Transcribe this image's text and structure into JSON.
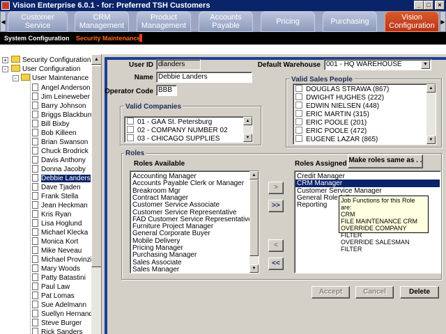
{
  "window": {
    "title": "Vision Enterprise 6.0.1 - for: Preferred TSH Customers",
    "minimize": "_",
    "maximize": "□",
    "close": "×"
  },
  "tabs": [
    {
      "label": "Customer Service"
    },
    {
      "label": "CRM Management"
    },
    {
      "label": "Product Management"
    },
    {
      "label": "Accounts Payable"
    },
    {
      "label": "Pricing"
    },
    {
      "label": "Purchasing"
    },
    {
      "label": "Vision Configuration"
    }
  ],
  "tab_scroll": {
    "left": "◀",
    "right": "▶"
  },
  "subnav": {
    "system_config": "System Configuration",
    "security_maint": "Security Maintenance"
  },
  "colors": {
    "subnav_white": "#ffffff",
    "subnav_orange": "#ff6a1a",
    "active_tab": "#c0441f"
  },
  "tree": {
    "nodes": [
      {
        "label": "Security Configuration",
        "type": "folder",
        "expander": "+"
      },
      {
        "label": "User Configuration",
        "type": "folder",
        "expander": "-"
      },
      {
        "label": "User Maintenance",
        "type": "folder",
        "expander": "-"
      }
    ],
    "users": [
      "Angel Anderson",
      "Jim Leineweber",
      "Barry Johnson",
      "Briggs Blackburn",
      "Bill Bixby",
      "Bob Killeen",
      "Brian Swanson",
      "Chuck Brodrick",
      "Davis Anthony",
      "Donna Jacoby",
      "Debbie Landers",
      "Dave Tjaden",
      "Frank Stella",
      "Jean Heckman",
      "Kris Ryan",
      "Lisa Hoglund",
      "Michael Klecka",
      "Monica Kort",
      "Mike Neveau",
      "Michael Provinzino",
      "Mary Woods",
      "Patty Batastini",
      "Paul Law",
      "Pat Lomas",
      "Sue Adelmann",
      "Suellyn Hernandez",
      "Steve Burger",
      "Rick Sanders"
    ],
    "selected_user": "Debbie Landers"
  },
  "form": {
    "user_id_label": "User ID",
    "user_id": "dlanders",
    "name_label": "Name",
    "name": "Debbie Landers",
    "operator_code_label": "Operator Code",
    "operator_code": "BBB",
    "default_warehouse_label": "Default Warehouse",
    "default_warehouse": "001 - HQ WAREHOUSE"
  },
  "valid_companies": {
    "caption": "Valid Companies",
    "items": [
      "01 - GAA St. Petersburg",
      "02 - COMPANY NUMBER 02",
      "03 - CHICAGO SUPPLIES"
    ]
  },
  "valid_sales_people": {
    "caption": "Valid Sales People",
    "items": [
      "DOUGLAS STRAWA (867)",
      "DWIGHT HUGHES (222)",
      "EDWIN NIELSEN (448)",
      "ERIC MARTIN (315)",
      "ERIC POOLE (201)",
      "ERIC POOLE (472)",
      "EUGENE LAZAR (865)"
    ]
  },
  "roles": {
    "caption": "Roles",
    "available_label": "Roles Available",
    "assigned_label": "Roles Assigned",
    "make_same_label": "Make roles same as . . .",
    "available": [
      "Accounting Manager",
      "Accounts Payable Clerk or Manager",
      "Breakroom Mgr",
      "Contract Manager",
      "Customer Service Associate",
      "Customer Service Representative",
      "FAD Customer Service Representative",
      "Furniture Project Manager",
      "General Corporate Buyer",
      "Mobile Delivery",
      "Pricing Manager",
      "Purchasing Manager",
      "Sales Associate",
      "Sales Manager"
    ],
    "assigned": [
      "Credit Manager",
      "CRM Manager",
      "Customer Service Manager",
      "General Role (all",
      "Reporting"
    ],
    "selected_assigned": "CRM Manager",
    "move_right": ">",
    "move_all_right": ">>",
    "move_left": "<",
    "move_all_left": "<<"
  },
  "tooltip": {
    "heading": "Job Functions for this Role are:",
    "lines": [
      "CRM",
      "FILE MAINTENANCE CRM",
      "OVERRIDE COMPANY FILTER",
      "OVERRIDE SALESMAN FILTER"
    ]
  },
  "actions": {
    "accept": "Accept",
    "cancel": "Cancel",
    "delete": "Delete"
  }
}
